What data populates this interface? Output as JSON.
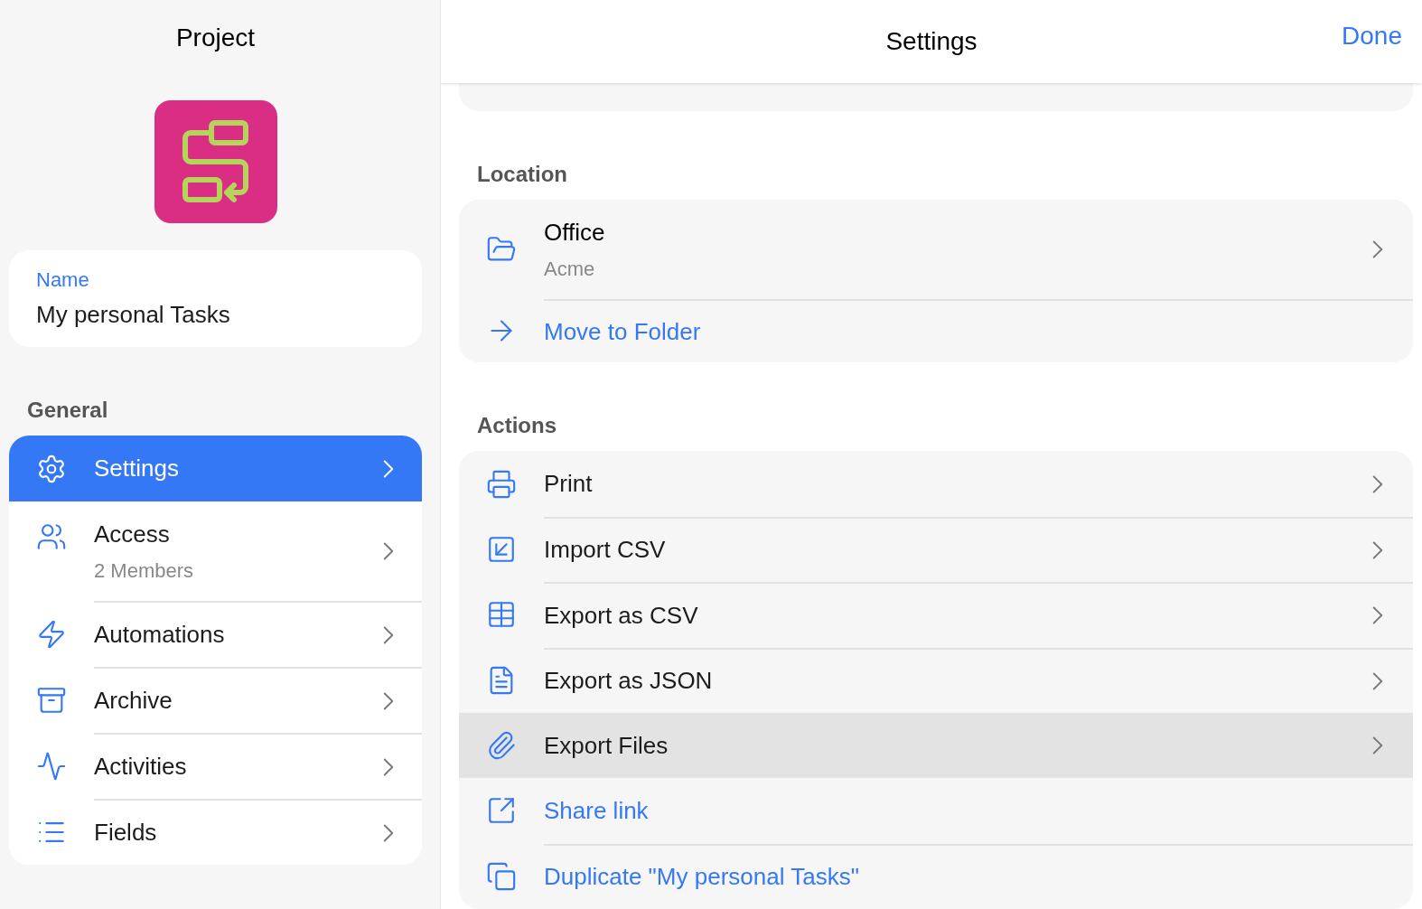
{
  "sidebar": {
    "title": "Project",
    "name_field": {
      "label": "Name",
      "value": "My personal Tasks"
    },
    "section": "General",
    "items": [
      {
        "label": "Settings",
        "selected": true
      },
      {
        "label": "Access",
        "subtitle": "2 Members",
        "selected": false
      },
      {
        "label": "Automations",
        "selected": false
      },
      {
        "label": "Archive",
        "selected": false
      },
      {
        "label": "Activities",
        "selected": false
      },
      {
        "label": "Fields",
        "selected": false
      }
    ]
  },
  "main": {
    "title": "Settings",
    "done": "Done",
    "location": {
      "heading": "Location",
      "folder": {
        "label": "Office",
        "subtitle": "Acme"
      },
      "move": "Move to Folder"
    },
    "actions": {
      "heading": "Actions",
      "items": [
        {
          "kind": "nav",
          "label": "Print",
          "selected": false
        },
        {
          "kind": "nav",
          "label": "Import CSV",
          "selected": false
        },
        {
          "kind": "nav",
          "label": "Export as CSV",
          "selected": false
        },
        {
          "kind": "nav",
          "label": "Export as JSON",
          "selected": false
        },
        {
          "kind": "nav",
          "label": "Export Files",
          "selected": true
        },
        {
          "kind": "link",
          "label": "Share link",
          "selected": false
        },
        {
          "kind": "link",
          "label": "Duplicate \"My personal Tasks\"",
          "selected": false
        }
      ]
    }
  }
}
